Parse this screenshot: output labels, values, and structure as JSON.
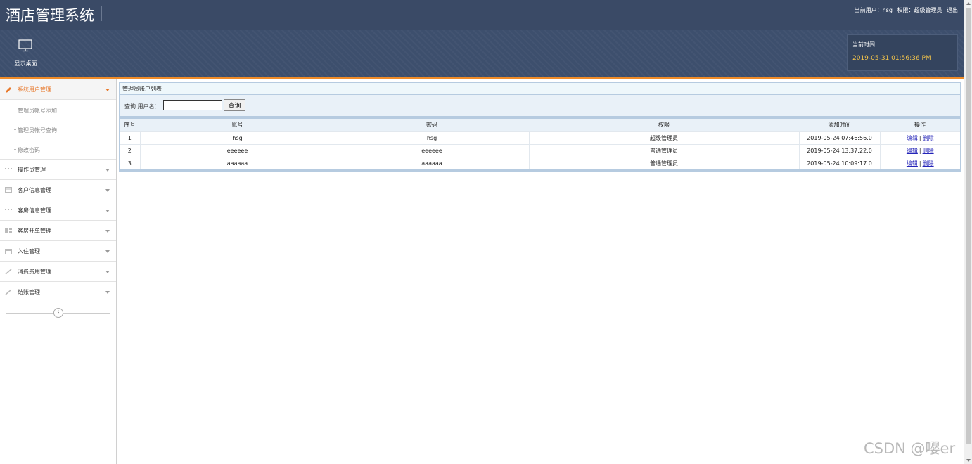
{
  "header": {
    "app_title": "酒店管理系统",
    "current_user_label": "当前用户：hsg",
    "permission_label": "权限：超级管理员",
    "logout_label": "退出"
  },
  "subbar": {
    "desktop_label": "显示桌面",
    "time_title": "当前时间",
    "time_value": "2019-05-31 01:56:36 PM"
  },
  "sidebar": {
    "menus": [
      {
        "label": "系统用户管理",
        "icon": "pencil-icon",
        "expanded": true,
        "items": [
          "管理员帐号添加",
          "管理员帐号查询",
          "修改密码"
        ]
      },
      {
        "label": "操作员管理",
        "icon": "list-icon"
      },
      {
        "label": "客户信息管理",
        "icon": "card-icon"
      },
      {
        "label": "客房信息管理",
        "icon": "list-icon"
      },
      {
        "label": "客房开单管理",
        "icon": "grid-icon"
      },
      {
        "label": "入住管理",
        "icon": "calendar-icon"
      },
      {
        "label": "消费费用管理",
        "icon": "brush-icon"
      },
      {
        "label": "结账管理",
        "icon": "brush-icon"
      }
    ],
    "collapse_glyph": "‹"
  },
  "main": {
    "panel_title": "管理员账户列表",
    "search_label": "查询 用户名：",
    "search_value": "",
    "search_button": "查询",
    "columns": [
      "序号",
      "账号",
      "密码",
      "权限",
      "添加时间",
      "操作"
    ],
    "rows": [
      [
        "1",
        "hsg",
        "hsg",
        "超级管理员",
        "2019-05-24 07:46:56.0"
      ],
      [
        "2",
        "eeeeee",
        "eeeeee",
        "普通管理员",
        "2019-05-24 13:37:22.0"
      ],
      [
        "3",
        "aaaaaa",
        "aaaaaa",
        "普通管理员",
        "2019-05-24 10:09:17.0"
      ]
    ],
    "edit_label": "编辑",
    "delete_label": "删除",
    "separator": "|"
  },
  "watermark": "CSDN @嘤er",
  "colors": {
    "header_bg": "#3a4a66",
    "accent_orange": "#f08c28",
    "time_yellow": "#f3c44b",
    "link_blue": "#2424b8"
  }
}
